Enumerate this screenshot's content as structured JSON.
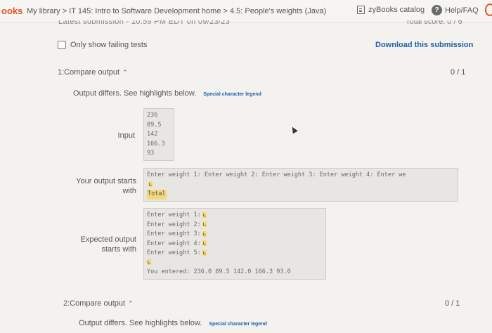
{
  "header": {
    "brand": "ooks",
    "breadcrumb": "My library > IT 145: Intro to Software Development home > 4.5: People's weights (Java)",
    "catalog_label": "zyBooks catalog",
    "help_label": "Help/FAQ"
  },
  "submission": {
    "latest_text": "Latest submission - 10:59 PM EDT on 09/23/23",
    "total_score": "Total score: 0 / 6",
    "only_failing_label": "Only show failing tests",
    "download_label": "Download this submission"
  },
  "tests": [
    {
      "title": "1:Compare output",
      "score": "0 / 1",
      "differs": "Output differs. See highlights below.",
      "legend": "Special character legend",
      "input_label": "Input",
      "input_lines": [
        "236",
        "89.5",
        "142",
        "166.3",
        "93"
      ],
      "your_label_1": "Your output starts",
      "your_label_2": "with",
      "your_line": "Enter weight 1: Enter weight 2: Enter weight 3: Enter weight 4: Enter we",
      "your_total": "Total",
      "expected_label_1": "Expected output",
      "expected_label_2": "starts with",
      "expected_lines": [
        "Enter weight 1:",
        "Enter weight 2:",
        "Enter weight 3:",
        "Enter weight 4:",
        "Enter weight 5:"
      ],
      "expected_entered": "You entered: 236.0 89.5 142.0 166.3 93.0"
    },
    {
      "title": "2:Compare output",
      "score": "0 / 1",
      "differs": "Output differs. See highlights below.",
      "legend": "Special character legend"
    }
  ]
}
